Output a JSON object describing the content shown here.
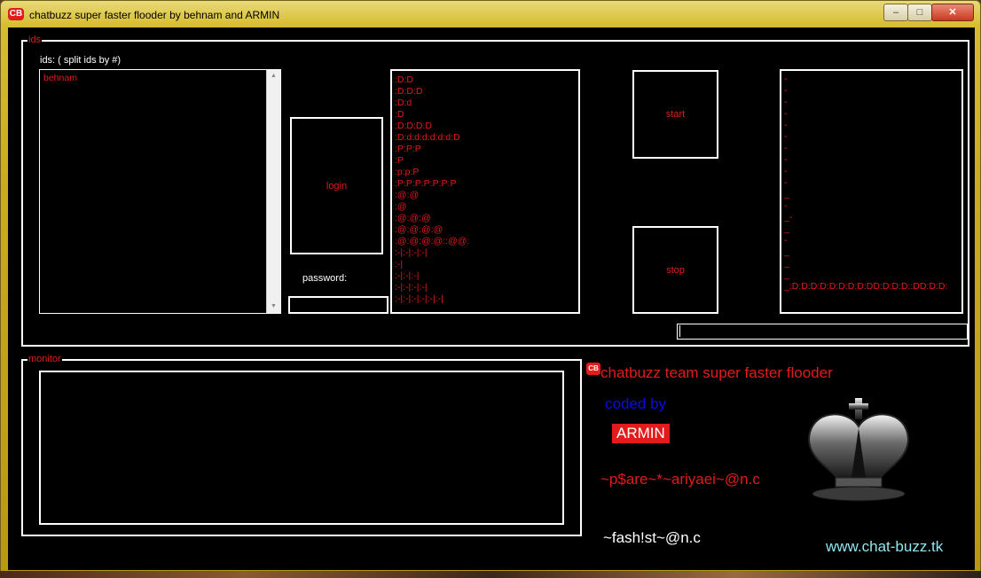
{
  "window": {
    "title": "chatbuzz super faster flooder by behnam and ARMIN",
    "icon_label": "CB",
    "controls": {
      "minimize": "–",
      "maximize": "□",
      "close": "✕"
    }
  },
  "ids_group": {
    "label": "ids",
    "ids_hint": "ids: ( split ids by #)",
    "ids_value": "behnam",
    "login_label": "login",
    "password_label": "password:",
    "password_value": "",
    "messages": [
      ":D:D",
      ":D:D:D",
      ":D:d",
      ":D",
      ":D:D:D:D",
      ":D:d:d:d:d:d:d:D",
      ":P:P:P",
      ":P",
      ":p:p:P",
      ":P:P:P:P:P:P:P",
      ":@:@",
      ":@",
      ":@:@:@",
      ":@:@:@:@",
      ":@:@:@:@::@@:",
      ":-|:-|:-|:-|",
      ":-|",
      ":-|:-|:-|",
      ":-|:-|:-|:-|",
      ":-|:-|:-|:-|:-|:-|"
    ],
    "start_label": "start",
    "stop_label": "stop",
    "log_lines": [
      "-",
      "-",
      "-",
      "-",
      "-",
      "-",
      "-",
      "-",
      "-",
      "-",
      "_",
      "-",
      "_-",
      "_",
      "-",
      "_",
      "_",
      "_",
      "_:D:D:D:D:D:D:D:D:DD:D:D:D::DD:D:D:"
    ],
    "status_value": ""
  },
  "monitor_group": {
    "label": "monitor"
  },
  "credits": {
    "logo_label": "CB",
    "team": "chatbuzz team super faster flooder",
    "coded_by": "coded by",
    "author": "ARMIN",
    "line1": "~p$are~*~ariyaei~@n.c",
    "line2": "~fash!st~@n.c",
    "website": "www.chat-buzz.tk",
    "colors": {
      "red": "#e31b1b",
      "blue": "#0a0ae6",
      "cyan": "#8fe6f0",
      "white": "#ffffff"
    }
  }
}
